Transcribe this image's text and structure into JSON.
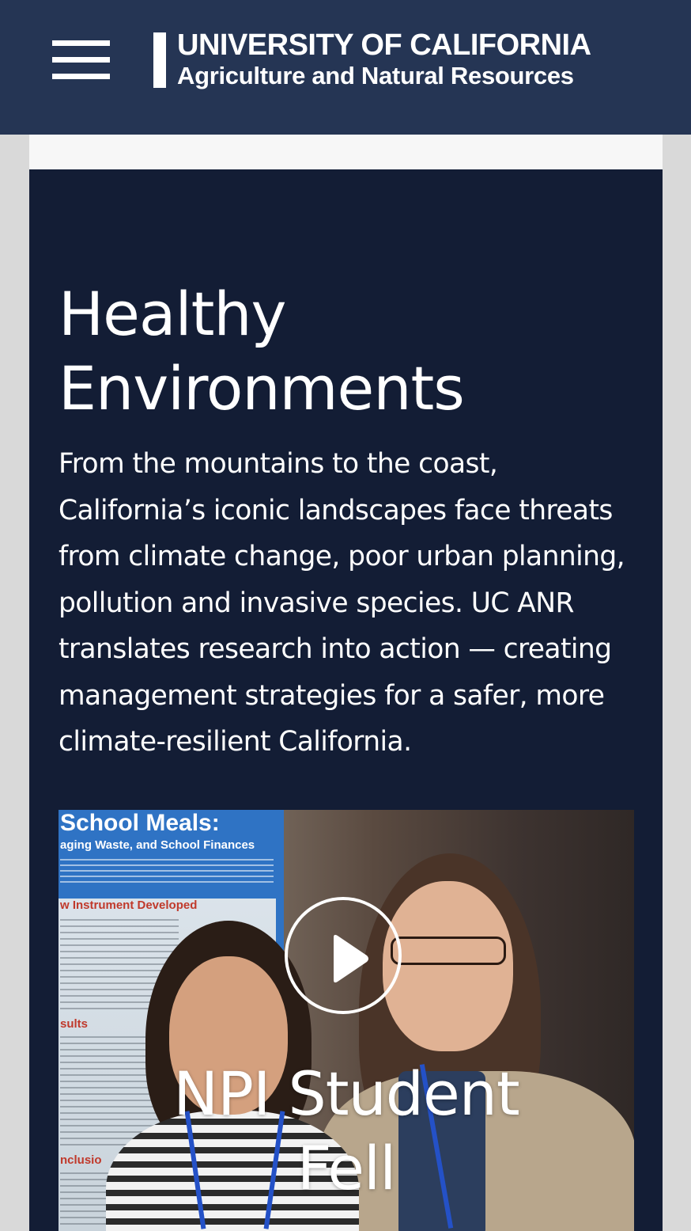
{
  "header": {
    "menu_icon": "hamburger-menu-icon",
    "logo": {
      "line1": "UNIVERSITY OF CALIFORNIA",
      "line2": "Agriculture and Natural Resources"
    },
    "background_color": "#253554"
  },
  "section": {
    "title": "Healthy Environments",
    "body": "From the mountains to the coast, California’s iconic landscapes face threats from climate change, poor urban planning, pollution and invasive species. UC ANR translates research into action — creating management strategies for a safer, more climate-resilient California.",
    "background_color": "#131d35"
  },
  "video": {
    "play_icon": "play-icon",
    "title": "NPI Student Fell",
    "poster": {
      "title": "School Meals:",
      "subtitle": "aging Waste, and School Finances",
      "section_heading": "w Instrument Developed",
      "results_heading": "sults",
      "conclusion_heading": "nclusio"
    }
  }
}
